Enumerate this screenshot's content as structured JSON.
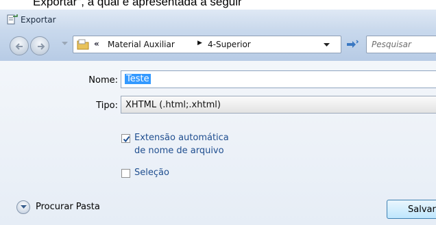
{
  "background_text": "Exportar\", a qual é apresentada a seguir",
  "dialog": {
    "title": "Exportar"
  },
  "navigation": {
    "breadcrumb_prefix": "«",
    "breadcrumbs": [
      "Material Auxiliar",
      "4-Superior"
    ],
    "search_placeholder": "Pesquisar"
  },
  "form": {
    "name_label": "Nome:",
    "name_value": "Teste",
    "type_label": "Tipo:",
    "type_value": "XHTML (.html;.xhtml)",
    "auto_extension": {
      "label_line1": "Extensão automática",
      "label_line2": "de nome de arquivo",
      "checked": true
    },
    "selection": {
      "label": "Seleção",
      "checked": false
    }
  },
  "footer": {
    "browse_folders_label": "Procurar Pasta",
    "save_label": "Salvar"
  },
  "colors": {
    "selection_highlight": "#3399ff",
    "checkbox_label": "#1f4e8f",
    "nav_background": "#c9d9ed"
  },
  "icons": {
    "title": "export-icon",
    "back": "back-arrow-icon",
    "forward": "forward-arrow-icon",
    "folder": "folder-icon",
    "refresh": "refresh-icon",
    "browse": "chevron-down-icon"
  }
}
